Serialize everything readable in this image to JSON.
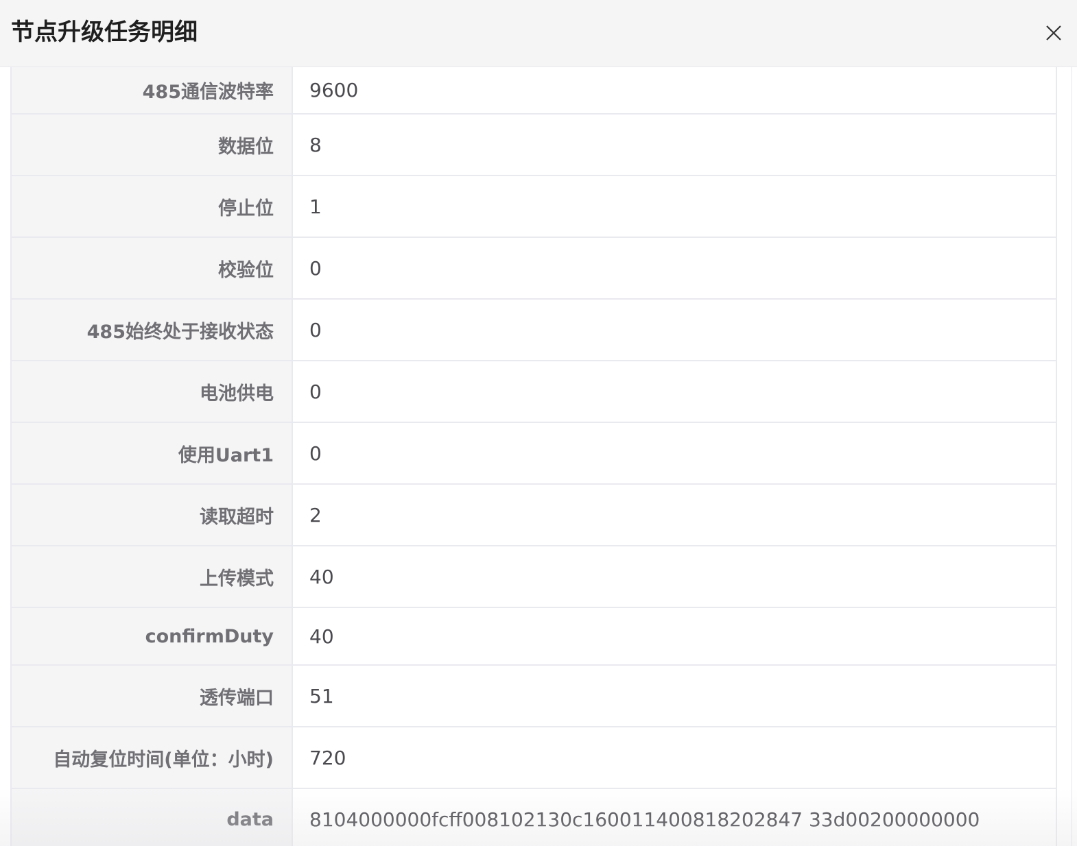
{
  "dialog": {
    "title": "节点升级任务明细",
    "close_icon": "close-icon"
  },
  "rows": [
    {
      "label": "485通信波特率",
      "value": "9600"
    },
    {
      "label": "数据位",
      "value": "8"
    },
    {
      "label": "停止位",
      "value": "1"
    },
    {
      "label": "校验位",
      "value": "0"
    },
    {
      "label": "485始终处于接收状态",
      "value": "0"
    },
    {
      "label": "电池供电",
      "value": "0"
    },
    {
      "label": "使用Uart1",
      "value": "0"
    },
    {
      "label": "读取超时",
      "value": "2"
    },
    {
      "label": "上传模式",
      "value": "40"
    },
    {
      "label": "confirmDuty",
      "value": "40"
    },
    {
      "label": "透传端口",
      "value": "51"
    },
    {
      "label": "自动复位时间(单位：小时)",
      "value": "720"
    },
    {
      "label": "data",
      "value": "8104000000fcff008102130c160011400818202847 33d00200000000"
    }
  ],
  "colors": {
    "header_bg": "#f5f5f5",
    "label_bg": "#f5f5f6",
    "border": "#e9e9f0",
    "label_text": "#6f6f74",
    "value_text": "#4a4a4f"
  }
}
